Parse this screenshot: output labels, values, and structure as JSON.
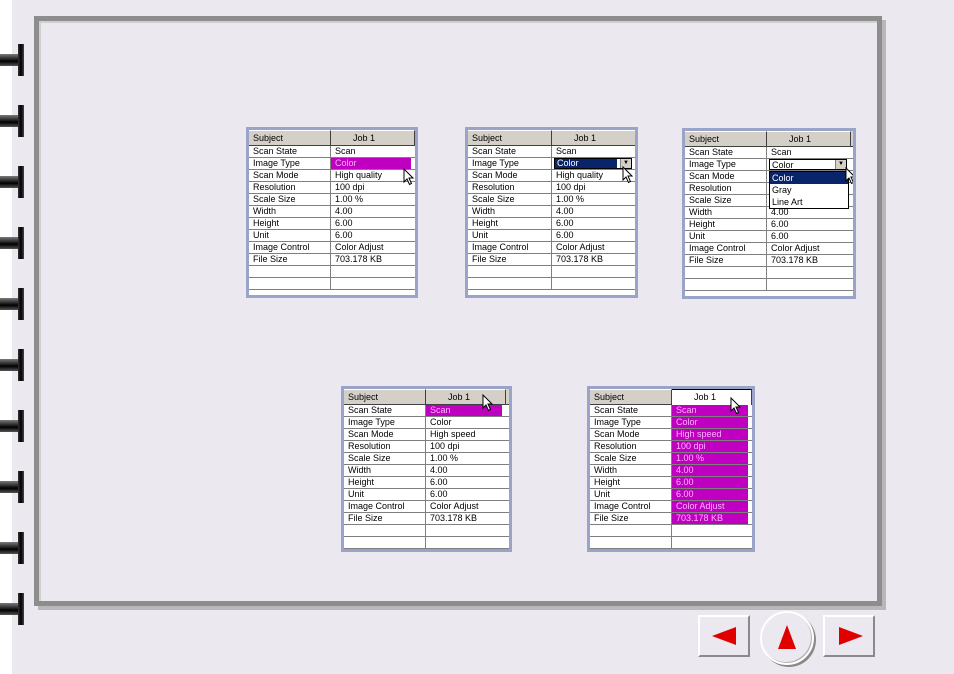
{
  "colors": {
    "highlight": "#c000c0",
    "selection": "#0a246a",
    "arrow": "#e00000",
    "frame": "#8d8d8d"
  },
  "nav": {
    "prev_icon": "left-arrow-icon",
    "home_icon": "up-arrow-icon",
    "next_icon": "right-arrow-icon"
  },
  "grids": [
    {
      "header": [
        "Subject",
        "Job 1"
      ],
      "rows": [
        [
          "Scan State",
          "Scan"
        ],
        [
          "Image Type",
          "Color"
        ],
        [
          "Scan Mode",
          "High quality"
        ],
        [
          "Resolution",
          "100 dpi"
        ],
        [
          "Scale Size",
          "1.00 %"
        ],
        [
          "Width",
          "4.00"
        ],
        [
          "Height",
          "6.00"
        ],
        [
          "Unit",
          "6.00"
        ],
        [
          "Image Control",
          "Color Adjust"
        ],
        [
          "File Size",
          "703.178 KB"
        ]
      ]
    },
    {
      "header": [
        "Subject",
        "Job 1"
      ],
      "rows": [
        [
          "Scan State",
          "Scan"
        ],
        [
          "Image Type",
          "Color"
        ],
        [
          "Scan Mode",
          "High quality"
        ],
        [
          "Resolution",
          "100 dpi"
        ],
        [
          "Scale Size",
          "1.00 %"
        ],
        [
          "Width",
          "4.00"
        ],
        [
          "Height",
          "6.00"
        ],
        [
          "Unit",
          "6.00"
        ],
        [
          "Image Control",
          "Color Adjust"
        ],
        [
          "File Size",
          "703.178 KB"
        ]
      ]
    },
    {
      "header": [
        "Subject",
        "Job 1"
      ],
      "rows": [
        [
          "Scan State",
          "Scan"
        ],
        [
          "Image Type",
          "Color"
        ],
        [
          "Scan Mode",
          ""
        ],
        [
          "Resolution",
          ""
        ],
        [
          "Scale Size",
          ""
        ],
        [
          "Width",
          "4.00"
        ],
        [
          "Height",
          "6.00"
        ],
        [
          "Unit",
          "6.00"
        ],
        [
          "Image Control",
          "Color Adjust"
        ],
        [
          "File Size",
          "703.178 KB"
        ]
      ],
      "dropdown_options": [
        "Color",
        "Gray",
        "Line Art"
      ]
    },
    {
      "header": [
        "Subject",
        "Job 1"
      ],
      "rows": [
        [
          "Scan State",
          "Scan"
        ],
        [
          "Image Type",
          "Color"
        ],
        [
          "Scan Mode",
          "High speed"
        ],
        [
          "Resolution",
          "100 dpi"
        ],
        [
          "Scale Size",
          "1.00 %"
        ],
        [
          "Width",
          "4.00"
        ],
        [
          "Height",
          "6.00"
        ],
        [
          "Unit",
          "6.00"
        ],
        [
          "Image Control",
          "Color Adjust"
        ],
        [
          "File Size",
          "703.178 KB"
        ]
      ]
    },
    {
      "header": [
        "Subject",
        "Job 1"
      ],
      "rows": [
        [
          "Scan State",
          "Scan"
        ],
        [
          "Image Type",
          "Color"
        ],
        [
          "Scan Mode",
          "High speed"
        ],
        [
          "Resolution",
          "100 dpi"
        ],
        [
          "Scale Size",
          "1.00 %"
        ],
        [
          "Width",
          "4.00"
        ],
        [
          "Height",
          "6.00"
        ],
        [
          "Unit",
          "6.00"
        ],
        [
          "Image Control",
          "Color Adjust"
        ],
        [
          "File Size",
          "703.178 KB"
        ]
      ]
    }
  ]
}
